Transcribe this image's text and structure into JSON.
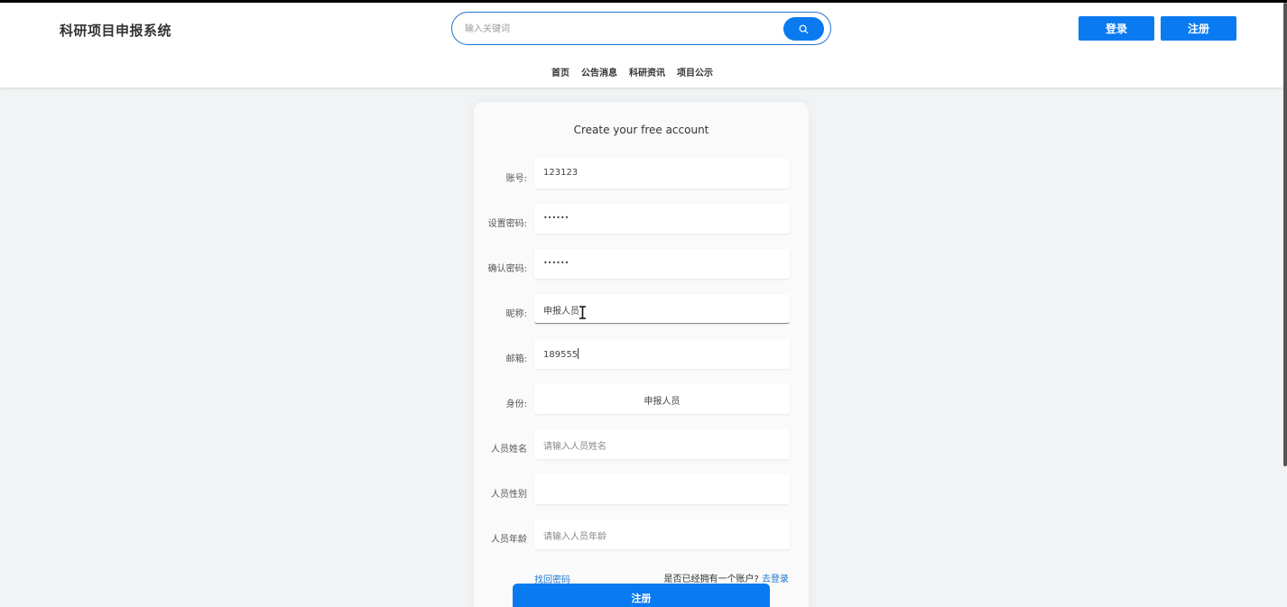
{
  "header": {
    "brand": "科研项目申报系统",
    "search_placeholder": "输入关键词",
    "login_label": "登录",
    "register_label": "注册"
  },
  "nav": {
    "items": [
      "首页",
      "公告消息",
      "科研资讯",
      "项目公示"
    ]
  },
  "form": {
    "title": "Create your free account",
    "fields": [
      {
        "label": "账号:",
        "value": "123123"
      },
      {
        "label": "设置密码:",
        "value": "••••••"
      },
      {
        "label": "确认密码:",
        "value": "••••••"
      },
      {
        "label": "昵称:",
        "value": "申报人员"
      },
      {
        "label": "邮箱:",
        "value": "189555"
      },
      {
        "label": "身份:",
        "value": "申报人员"
      },
      {
        "label": "人员姓名",
        "placeholder": "请输入人员姓名"
      },
      {
        "label": "人员性别",
        "value": ""
      },
      {
        "label": "人员年龄",
        "placeholder": "请输入人员年龄"
      }
    ],
    "forgot_label": "找回密码",
    "have_account_text": "是否已经拥有一个账户?",
    "go_login_label": "去登录",
    "submit_label": "注册"
  },
  "colors": {
    "accent": "#0a7af0",
    "link": "#1f77d0",
    "background": "#f2f3f4"
  }
}
